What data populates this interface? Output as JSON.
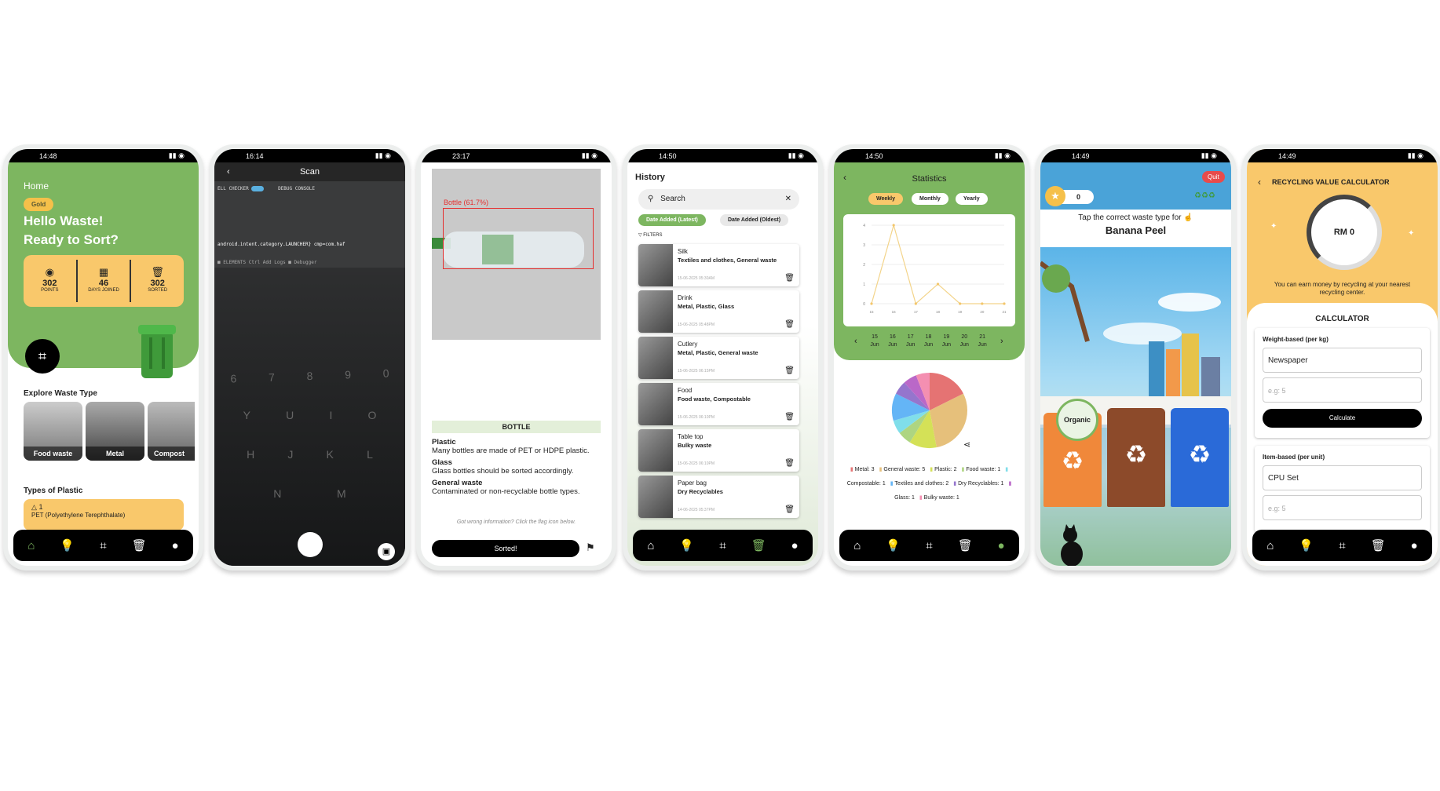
{
  "screens": {
    "home": {
      "time": "14:48",
      "home_label": "Home",
      "badge": "Gold",
      "greeting_line1": "Hello Waste!",
      "greeting_line2": "Ready to Sort?",
      "stats": [
        {
          "value": "302",
          "label": "POINTS",
          "icon": "coins-icon"
        },
        {
          "value": "46",
          "label": "DAYS JOINED",
          "icon": "calendar-icon"
        },
        {
          "value": "302",
          "label": "SORTED",
          "icon": "bin-icon"
        }
      ],
      "explore_title": "Explore Waste Type",
      "tiles": [
        "Food waste",
        "Metal",
        "Compost"
      ],
      "plastic_title": "Types of Plastic",
      "plastic_number": "1",
      "plastic_item": "PET (Polyethylene Terephthalate)"
    },
    "scan": {
      "time": "16:14",
      "title": "Scan",
      "toolbar_left": "ELL CHECKER",
      "toolbar_right": "DEBUG CONSOLE",
      "screen_text_1": "android.intent.category.LAUNCHER} cmp=com.haf",
      "screen_text_2": "■ ELEMENTS  Ctrl  Add Logs  ■ Debugger",
      "keys_row1": [
        "6",
        "7",
        "8",
        "9",
        "0"
      ],
      "keys_row2": [
        "Y",
        "U",
        "I",
        "O"
      ],
      "keys_row3": [
        "H",
        "J",
        "K",
        "L"
      ],
      "keys_row4": [
        "N",
        "M"
      ]
    },
    "result": {
      "time": "23:17",
      "detection": "Bottle (61.7%)",
      "header": "BOTTLE",
      "items": [
        {
          "title": "Plastic",
          "text": "Many bottles are made of PET or HDPE plastic."
        },
        {
          "title": "Glass",
          "text": "Glass bottles should be sorted accordingly."
        },
        {
          "title": "General waste",
          "text": "Contaminated or non-recyclable bottle types."
        }
      ],
      "hint": "Got wrong information? Click the flag icon below.",
      "button": "Sorted!"
    },
    "history": {
      "time": "14:50",
      "title": "History",
      "search_placeholder": "Search",
      "sort_latest": "Date Added (Latest)",
      "sort_oldest": "Date Added (Oldest)",
      "filters": "FILTERS",
      "items": [
        {
          "name": "Silk",
          "types": "Textiles and clothes, General waste",
          "date": "15-06-2025 05:30AM"
        },
        {
          "name": "Drink",
          "types": "Metal, Plastic, Glass",
          "date": "15-06-2025 05:48PM"
        },
        {
          "name": "Cutlery",
          "types": "Metal, Plastic, General waste",
          "date": "15-06-2025 06:15PM"
        },
        {
          "name": "Food",
          "types": "Food waste, Compostable",
          "date": "15-06-2025 06:10PM"
        },
        {
          "name": "Table top",
          "types": "Bulky waste",
          "date": "15-06-2025 06:10PM"
        },
        {
          "name": "Paper bag",
          "types": "Dry Recyclables",
          "date": "14-06-2025 05:37PM"
        }
      ]
    },
    "statistics": {
      "time": "14:50",
      "title": "Statistics",
      "tabs": [
        "Weekly",
        "Monthly",
        "Yearly"
      ],
      "days": [
        "15",
        "16",
        "17",
        "18",
        "19",
        "20",
        "21"
      ],
      "month": "Jun",
      "legend": [
        "Metal: 3",
        "General waste: 5",
        "Plastic: 2",
        "Food waste: 1",
        "Compostable: 1",
        "Textiles and clothes: 2",
        "Dry Recyclables: 1",
        "Glass: 1",
        "Bulky waste: 1"
      ]
    },
    "game": {
      "time": "14:49",
      "quit": "Quit",
      "score": "0",
      "prompt": "Tap the correct waste type for",
      "item": "Banana Peel",
      "organic_label": "Organic"
    },
    "calculator": {
      "time": "14:49",
      "title": "RECYCLING VALUE CALCULATOR",
      "amount": "RM 0",
      "subtitle": "You can earn money by recycling at your nearest recycling center.",
      "section": "CALCULATOR",
      "weight_label": "Weight-based (per kg)",
      "weight_item": "Newspaper",
      "weight_placeholder": "e.g: 5",
      "calc_button": "Calculate",
      "item_label": "Item-based (per unit)",
      "item_value": "CPU Set",
      "item_placeholder": "e.g: 5"
    }
  },
  "chart_data": {
    "type": "line",
    "x": [
      "15 Jun",
      "16 Jun",
      "17 Jun",
      "18 Jun",
      "19 Jun",
      "20 Jun",
      "21 Jun"
    ],
    "y": [
      0,
      4,
      0,
      1,
      0,
      0,
      0
    ],
    "ylim": [
      0,
      4
    ],
    "pie": {
      "labels": [
        "Metal",
        "General waste",
        "Plastic",
        "Food waste",
        "Compostable",
        "Textiles and clothes",
        "Dry Recyclables",
        "Glass",
        "Bulky waste"
      ],
      "values": [
        3,
        5,
        2,
        1,
        1,
        2,
        1,
        1,
        1
      ],
      "colors": [
        "#e57373",
        "#e6c07b",
        "#d4e157",
        "#aed581",
        "#80deea",
        "#64b5f6",
        "#9575cd",
        "#ba68c8",
        "#f48fb1"
      ]
    }
  },
  "colors": {
    "accent": "#7db660",
    "gold": "#f5c04a",
    "orange": "#f9c86b"
  }
}
